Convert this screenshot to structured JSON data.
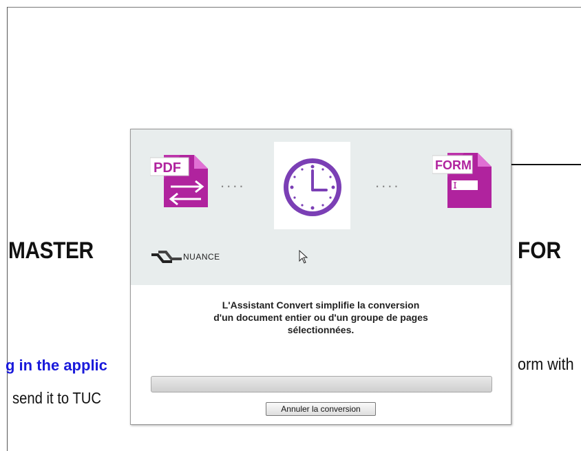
{
  "document": {
    "heading_left": "MASTER",
    "heading_right": "FOR",
    "line1_left": "g in the applic",
    "line1_right": "orm with",
    "line2_left": "send it to TUC"
  },
  "dialog": {
    "icons": {
      "source_label": "PDF",
      "target_label": "FORM",
      "clock": "clock-icon"
    },
    "dots": "....",
    "brand": "NUANCE",
    "message_lines": [
      "L'Assistant Convert simplifie la conversion",
      "d'un document entier ou d'un groupe de pages",
      "sélectionnées."
    ],
    "progress": 0,
    "cancel_label": "Annuler la conversion",
    "colors": {
      "accent": "#b0239e",
      "accent_light": "#d94fc9",
      "clock": "#7b3fb5",
      "banner_bg": "#e8eded"
    }
  }
}
